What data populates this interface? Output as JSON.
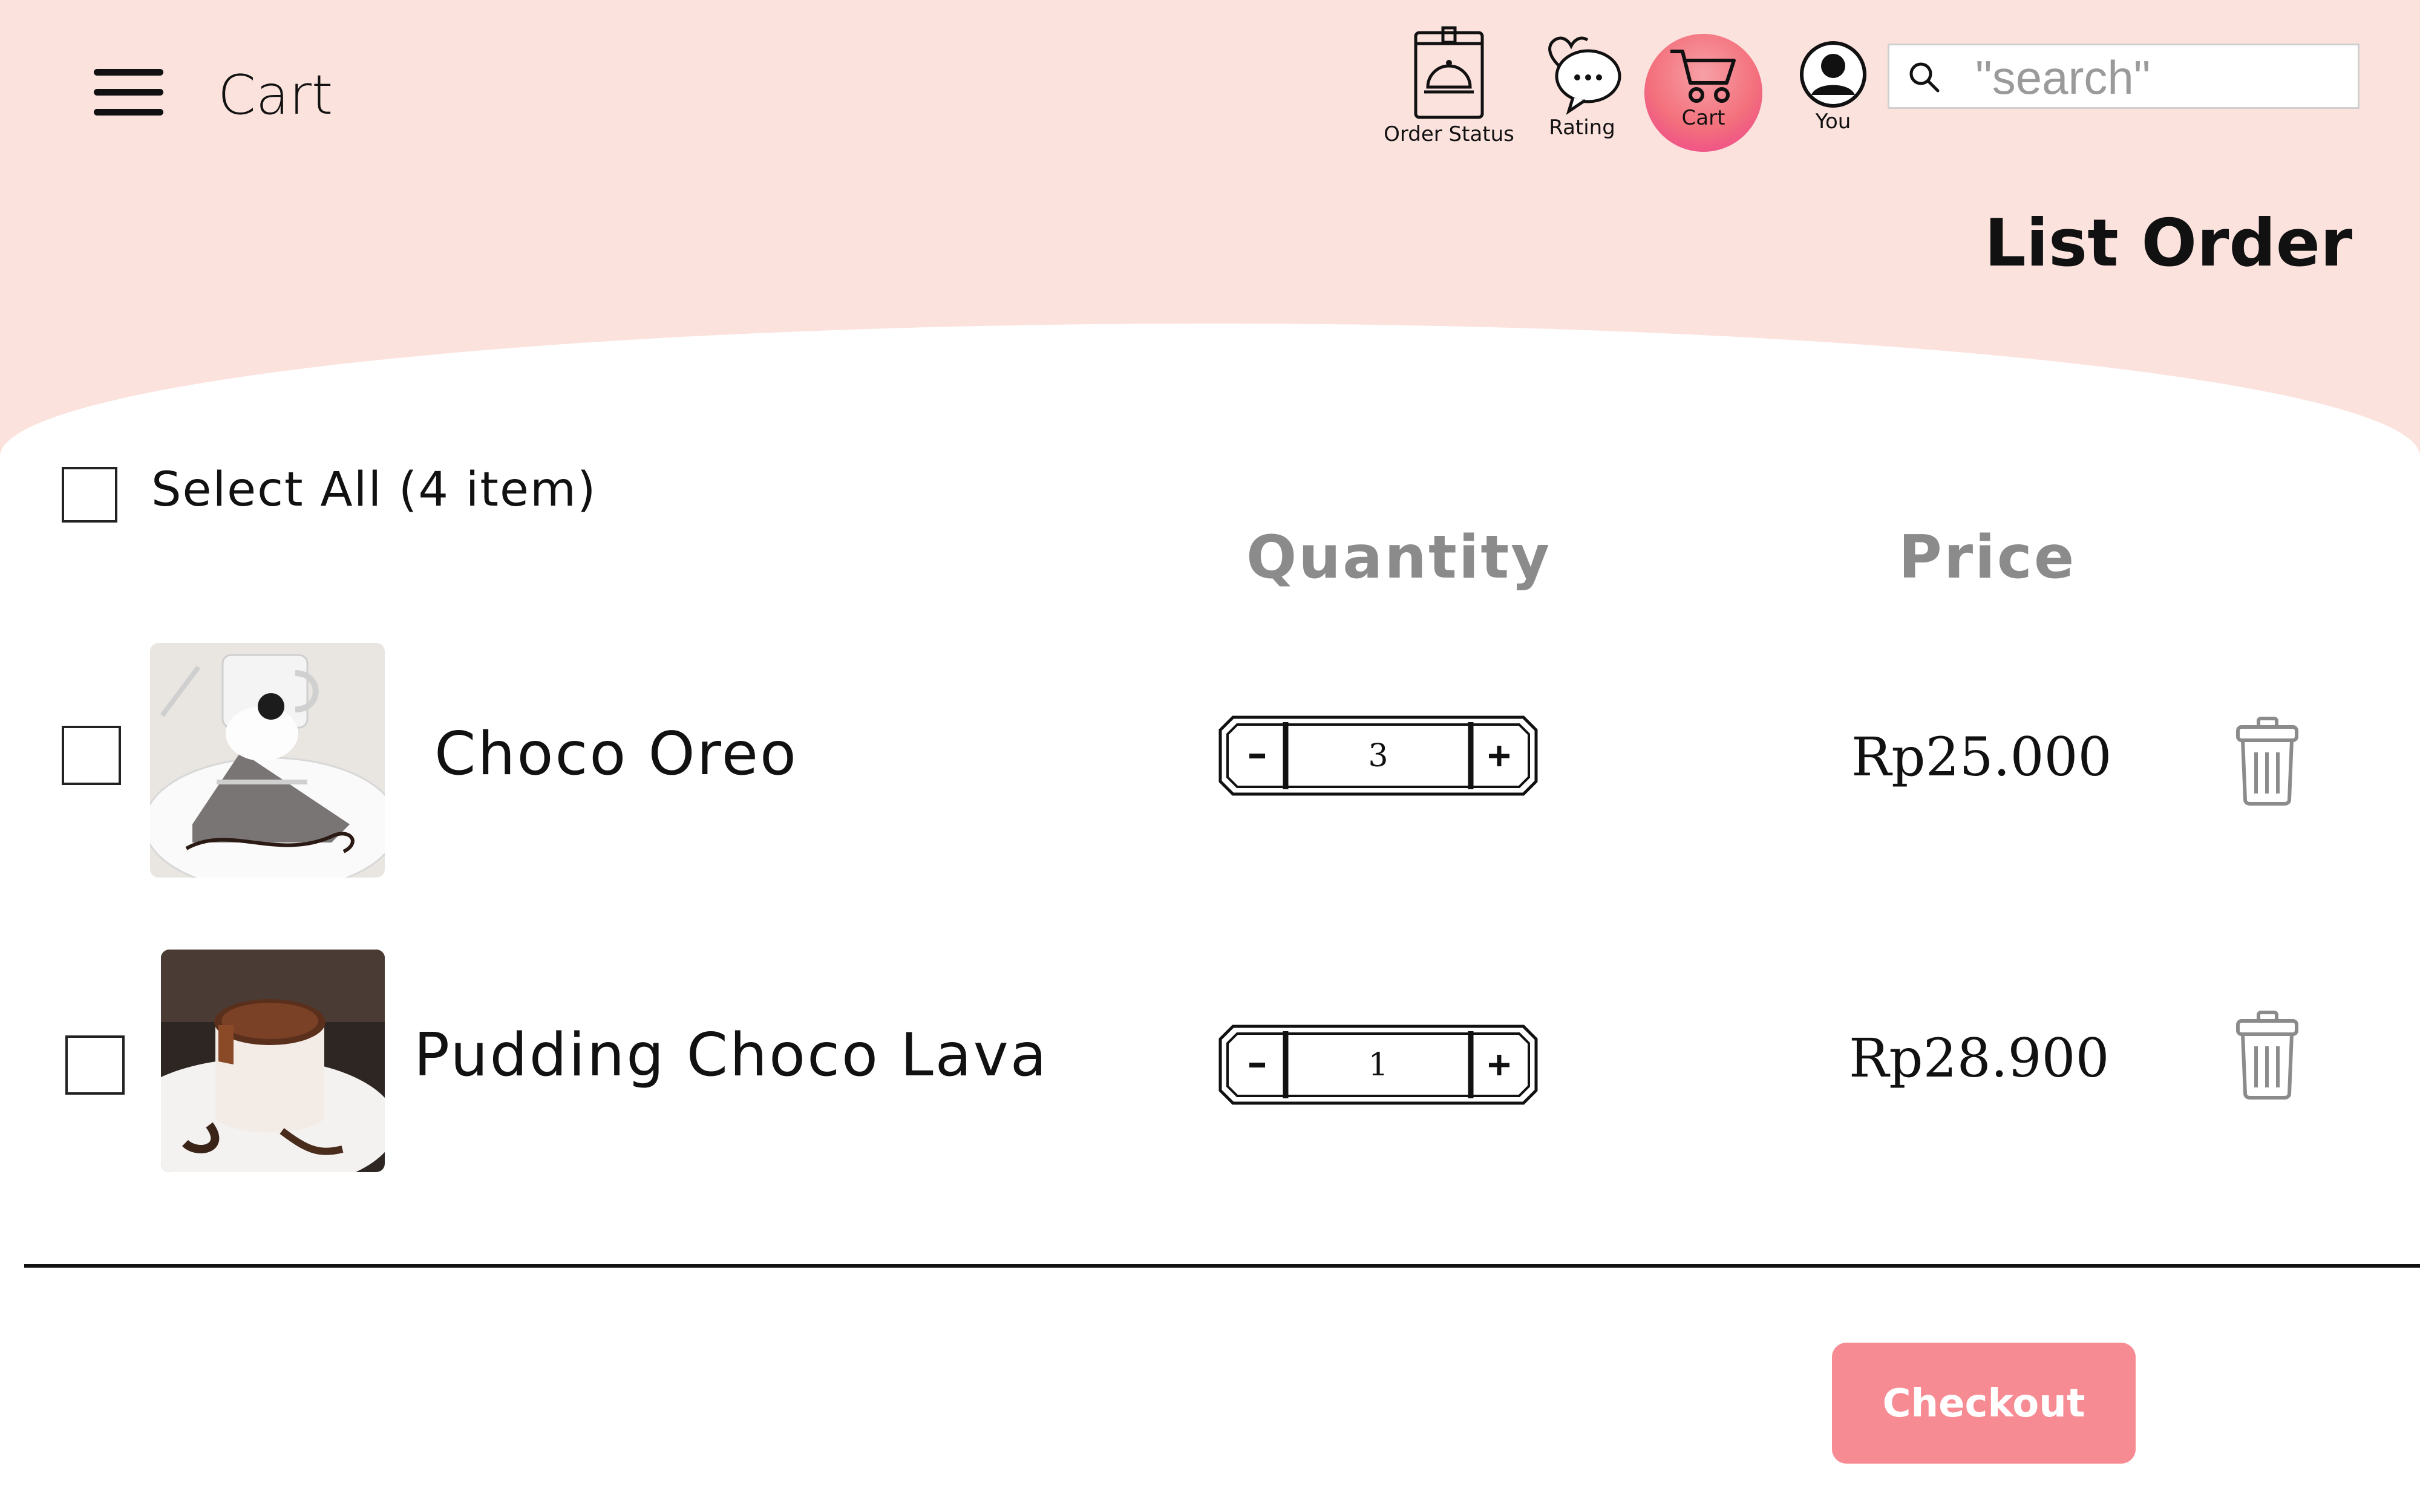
{
  "header": {
    "title": "Cart",
    "nav": [
      {
        "label": "Order Status",
        "icon": "order-status-icon"
      },
      {
        "label": "Rating",
        "icon": "rating-icon"
      },
      {
        "label": "Cart",
        "icon": "cart-icon",
        "active": true
      },
      {
        "label": "You",
        "icon": "user-icon"
      }
    ],
    "search": {
      "placeholder": "\"search\"",
      "value": ""
    }
  },
  "list_title": "List Order",
  "select_all": {
    "label": "Select All (4 item)",
    "checked": false
  },
  "columns": {
    "quantity": "Quantity",
    "price": "Price"
  },
  "items": [
    {
      "name": "Choco Oreo",
      "quantity": "3",
      "price": "Rp25.000",
      "checked": false,
      "image": "choco-oreo-cake-image"
    },
    {
      "name": "Pudding Choco Lava",
      "quantity": "1",
      "price": "Rp28.900",
      "checked": false,
      "image": "pudding-choco-lava-image"
    }
  ],
  "stepper": {
    "minus": "-",
    "plus": "+"
  },
  "checkout": {
    "label": "Checkout"
  },
  "colors": {
    "header_bg": "#fbe2dd",
    "accent": "#f78b93",
    "cart_active": "#f3707c",
    "muted": "#8b8b8b"
  }
}
